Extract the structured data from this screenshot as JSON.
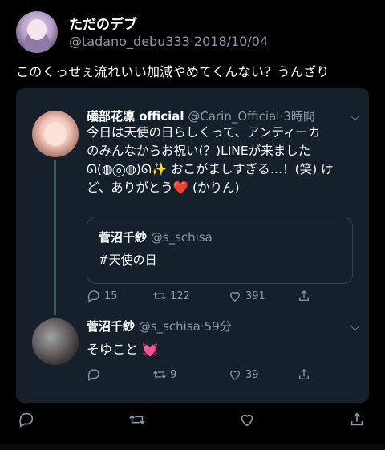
{
  "outer_tweet": {
    "author_name": "ただのデブ",
    "handle": "@tadano_debu333",
    "date": "2018/10/04",
    "text": "このくっせぇ流れいい加減やめてくんない？うんざり"
  },
  "quoted_tweet": {
    "author_name": "礒部花凜 official",
    "handle": "@Carin_Official",
    "time": "3時間",
    "text_lines": [
      "今日は天使の日らしくって、アンティーカ",
      "のみんなからお祝い(？)LINEが来ました",
      "ᘏ(◍ⓞ◍)ᘏ✨ おこがましすぎる…！(笑) け",
      "ど、ありがとう"
    ],
    "heart": "❤️",
    "text_tail": " (かりん)",
    "embedded": {
      "author_name": "菅沼千紗",
      "handle": "@s_schisa",
      "text": "#天使の日"
    },
    "counts": {
      "replies": "15",
      "retweets": "122",
      "likes": "391"
    }
  },
  "reply_tweet": {
    "author_name": "菅沼千紗",
    "handle": "@s_schisa",
    "time": "59分",
    "text": "そゆこと",
    "emoji": "💓",
    "counts": {
      "replies": "",
      "retweets": "9",
      "likes": "39"
    }
  },
  "separator": "·",
  "chevron": "⌵",
  "icons": {
    "reply": "reply-icon",
    "retweet": "retweet-icon",
    "like": "heart-icon",
    "share": "share-icon"
  },
  "colors": {
    "background": "#000000",
    "card": "#15202b",
    "muted": "#8b98a5",
    "heart": "#e0245e"
  }
}
